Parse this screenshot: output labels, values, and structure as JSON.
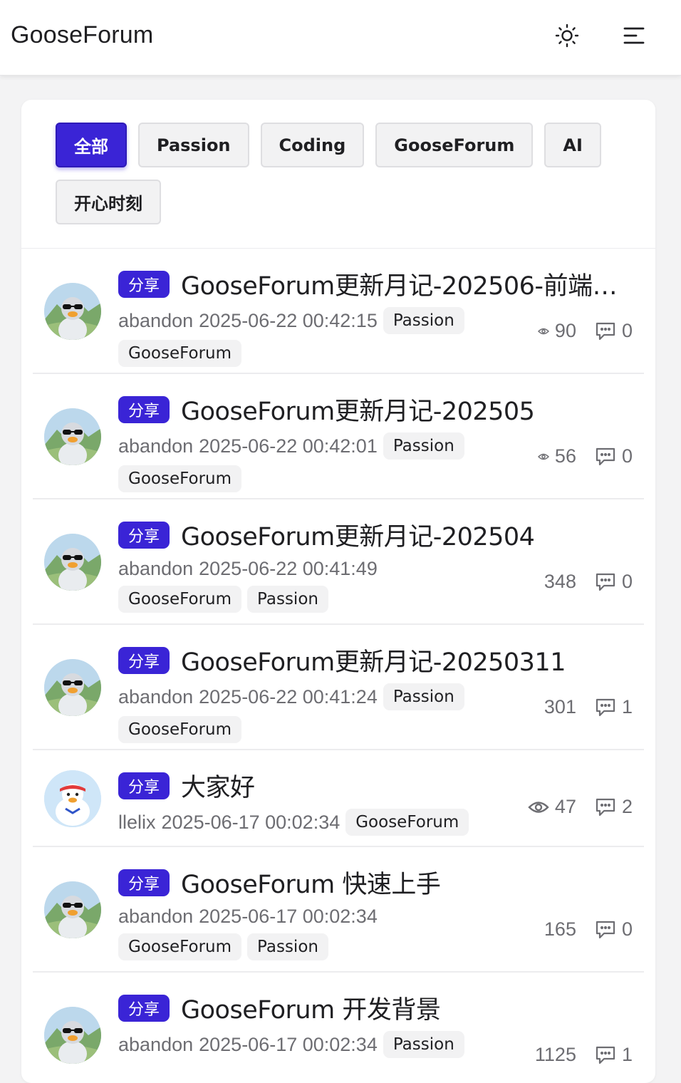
{
  "header": {
    "brand": "GooseForum"
  },
  "filters": [
    "全部",
    "Passion",
    "Coding",
    "GooseForum",
    "AI",
    "开心时刻"
  ],
  "posts": [
    {
      "tag": "分享",
      "title": "GooseForum更新月记-202506-前端…",
      "user": "abandon",
      "date": "2025-06-22 00:42:15",
      "labels": [
        "Passion",
        "GooseForum"
      ],
      "views": "90",
      "comments": "0"
    },
    {
      "tag": "分享",
      "title": "GooseForum更新月记-202505",
      "user": "abandon",
      "date": "2025-06-22 00:42:01",
      "labels": [
        "Passion",
        "GooseForum"
      ],
      "views": "56",
      "comments": "0"
    },
    {
      "tag": "分享",
      "title": "GooseForum更新月记-202504",
      "user": "abandon",
      "date": "2025-06-22 00:41:49",
      "labels": [
        "GooseForum",
        "Passion"
      ],
      "views": "348",
      "comments": "0"
    },
    {
      "tag": "分享",
      "title": "GooseForum更新月记-20250311",
      "user": "abandon",
      "date": "2025-06-22 00:41:24",
      "labels": [
        "Passion",
        "GooseForum"
      ],
      "views": "301",
      "comments": "1"
    },
    {
      "tag": "分享",
      "title": "大家好",
      "user": "llelix",
      "date": "2025-06-17 00:02:34",
      "labels": [
        "GooseForum"
      ],
      "views": "47",
      "comments": "2"
    },
    {
      "tag": "分享",
      "title": "GooseForum 快速上手",
      "user": "abandon",
      "date": "2025-06-17 00:02:34",
      "labels": [
        "GooseForum",
        "Passion"
      ],
      "views": "165",
      "comments": "0"
    },
    {
      "tag": "分享",
      "title": "GooseForum 开发背景",
      "user": "abandon",
      "date": "2025-06-17 00:02:34",
      "labels": [
        "Passion"
      ],
      "views": "1125",
      "comments": "1"
    }
  ],
  "colors": {
    "accent": "#3a24d6",
    "chip_bg": "#f2f2f3",
    "muted_text": "#6d6d72"
  }
}
